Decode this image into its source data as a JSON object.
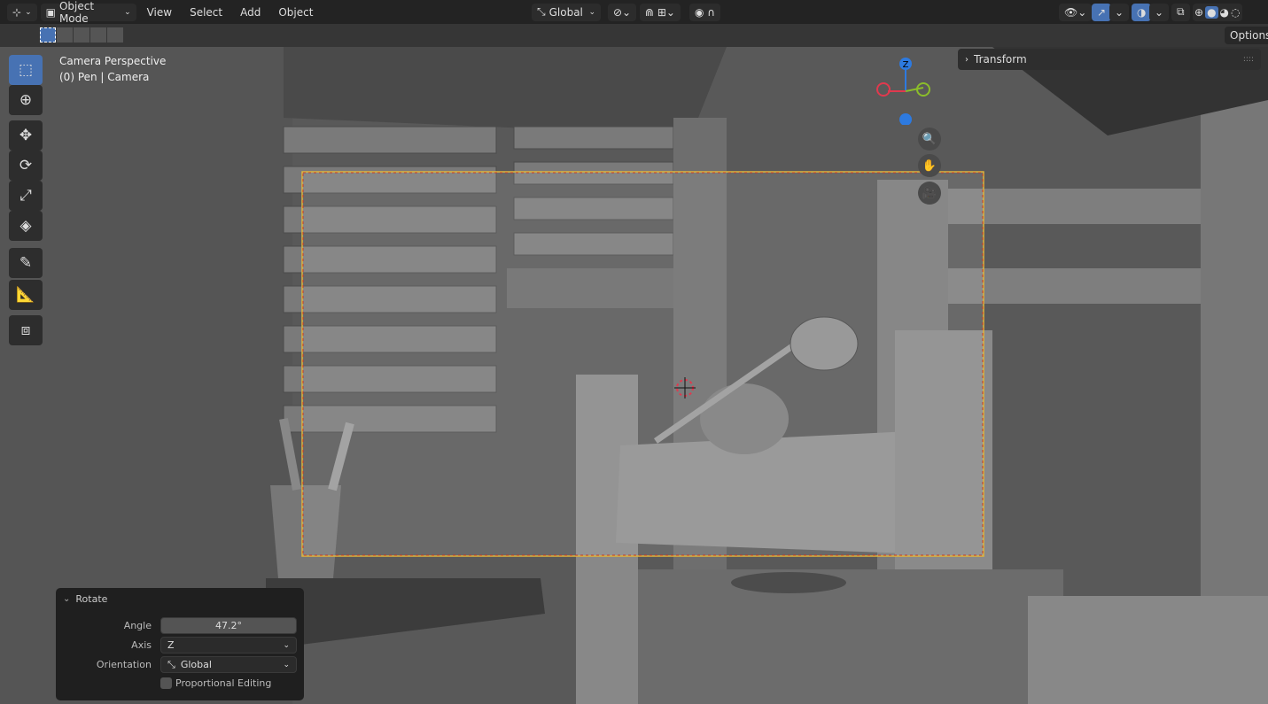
{
  "header": {
    "editor_type_icon": "3d-viewport-icon",
    "mode": "Object Mode",
    "menus": [
      "View",
      "Select",
      "Add",
      "Object"
    ],
    "transform_orientation": "Global",
    "options_label": "Options"
  },
  "viewport": {
    "title": "Camera Perspective",
    "subtitle": "(0) Pen | Camera",
    "transform_panel": "Transform",
    "gizmo_axes": {
      "z": "Z"
    },
    "colors": {
      "x": "#e0394e",
      "y": "#8bbd2a",
      "z": "#2d7ae0",
      "camera_frame": "#e0b43c"
    }
  },
  "toolbar": [
    "select-box",
    "cursor",
    "move",
    "rotate",
    "scale",
    "transform",
    "annotate",
    "measure",
    "add-cube"
  ],
  "operator_panel": {
    "title": "Rotate",
    "angle_label": "Angle",
    "angle_value": "47.2°",
    "axis_label": "Axis",
    "axis_value": "Z",
    "orientation_label": "Orientation",
    "orientation_value": "Global",
    "proportional_label": "Proportional Editing",
    "proportional_checked": false
  }
}
